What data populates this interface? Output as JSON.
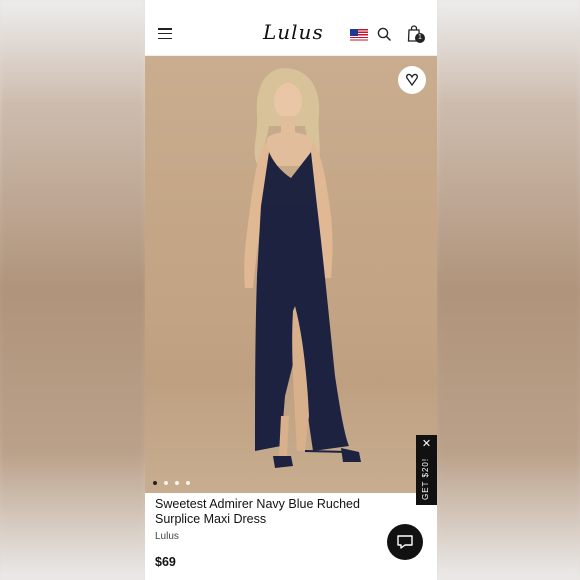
{
  "header": {
    "logo": "Lulus",
    "cart_count": "1"
  },
  "product": {
    "title": "Sweetest Admirer Navy Blue Ruched Surplice Maxi Dress",
    "brand": "Lulus",
    "price": "$69",
    "image_count": 4,
    "active_image": 1
  },
  "promo": {
    "label": "GET $20!",
    "close": "✕"
  },
  "icons": {
    "menu": "hamburger-icon",
    "flag": "us-flag-icon",
    "search": "search-icon",
    "bag": "shopping-bag-icon",
    "wishlist": "heart-icon",
    "chat": "chat-icon"
  },
  "colors": {
    "dress": "#1e2440",
    "background": "#c4a586",
    "accent": "#111111"
  }
}
